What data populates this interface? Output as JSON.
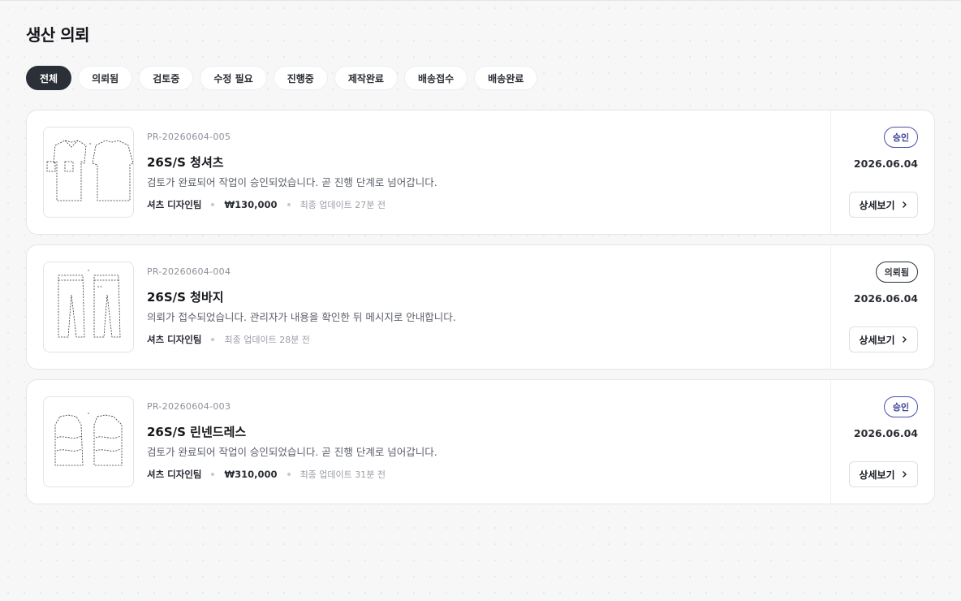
{
  "page": {
    "title": "생산 의뢰"
  },
  "tabs": [
    {
      "label": "전체",
      "active": true
    },
    {
      "label": "의뢰됨"
    },
    {
      "label": "검토중"
    },
    {
      "label": "수정 필요"
    },
    {
      "label": "진행중"
    },
    {
      "label": "제작완료"
    },
    {
      "label": "배송접수"
    },
    {
      "label": "배송완료"
    }
  ],
  "requests": [
    {
      "id": "PR-20260604-005",
      "title": "26S/S 청셔츠",
      "description": "검토가 완료되어 작업이 승인되었습니다. 곧 진행 단계로 넘어갑니다.",
      "team": "셔츠 디자인팀",
      "price": "₩130,000",
      "updated": "최종 업데이트 27분 전",
      "status": "승인",
      "date": "2026.06.04",
      "detail_label": "상세보기",
      "thumb_icon": "shirt-sketch-icon"
    },
    {
      "id": "PR-20260604-004",
      "title": "26S/S 청바지",
      "description": "의뢰가 접수되었습니다. 관리자가 내용을 확인한 뒤 메시지로 안내합니다.",
      "team": "셔츠 디자인팀",
      "updated": "최종 업데이트 28분 전",
      "status": "의뢰됨",
      "date": "2026.06.04",
      "detail_label": "상세보기",
      "thumb_icon": "pants-sketch-icon"
    },
    {
      "id": "PR-20260604-003",
      "title": "26S/S 린넨드레스",
      "description": "검토가 완료되어 작업이 승인되었습니다. 곧 진행 단계로 넘어갑니다.",
      "team": "셔츠 디자인팀",
      "price": "₩310,000",
      "updated": "최종 업데이트 31분 전",
      "status": "승인",
      "date": "2026.06.04",
      "detail_label": "상세보기",
      "thumb_icon": "dress-sketch-icon"
    }
  ],
  "colors": {
    "tab_active_bg": "#2b2f38",
    "badge_approved": "#3d4199",
    "badge_requested": "#2b2f38"
  }
}
